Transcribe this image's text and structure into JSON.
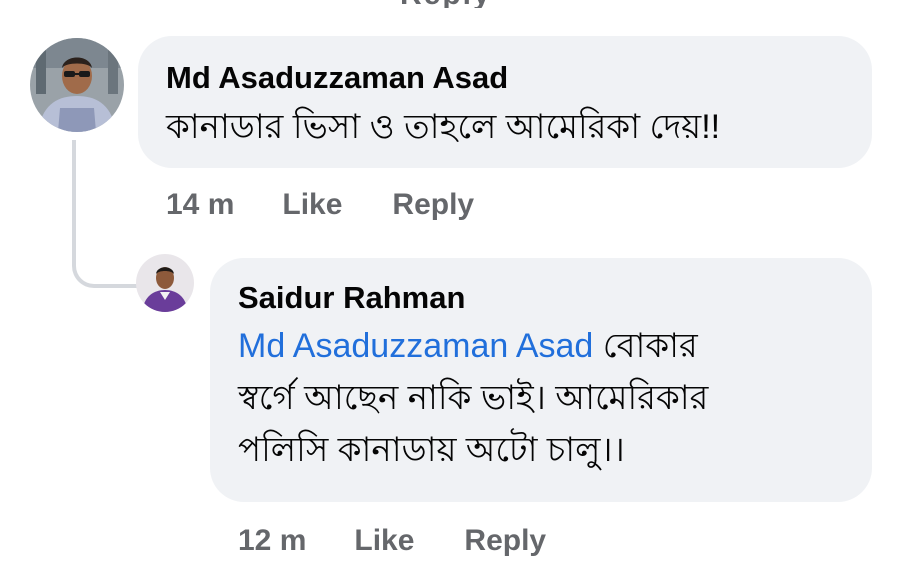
{
  "previous": {
    "partial_text": "Reply"
  },
  "comments": [
    {
      "author": "Md Asaduzzaman Asad",
      "text": "কানাডার ভিসা ও তাহলে আমেরিকা দেয়!!",
      "time": "14 m",
      "like_label": "Like",
      "reply_label": "Reply",
      "avatar_icon": "profile-photo-man-sunglasses"
    },
    {
      "author": "Saidur Rahman",
      "mention": "Md Asaduzzaman Asad",
      "text_line_1": "বোকার",
      "text_line_2": "স্বর্গে আছেন নাকি ভাই। আমেরিকার",
      "text_line_3": "পলিসি কানাডায় অটো চালু।।",
      "time": "12 m",
      "like_label": "Like",
      "reply_label": "Reply",
      "avatar_icon": "profile-photo-man-purple-shirt"
    }
  ],
  "colors": {
    "bubble_background": "#f0f2f5",
    "mention": "#216fdb",
    "meta_text": "#65676b",
    "thread_line": "#d5d8dd"
  }
}
